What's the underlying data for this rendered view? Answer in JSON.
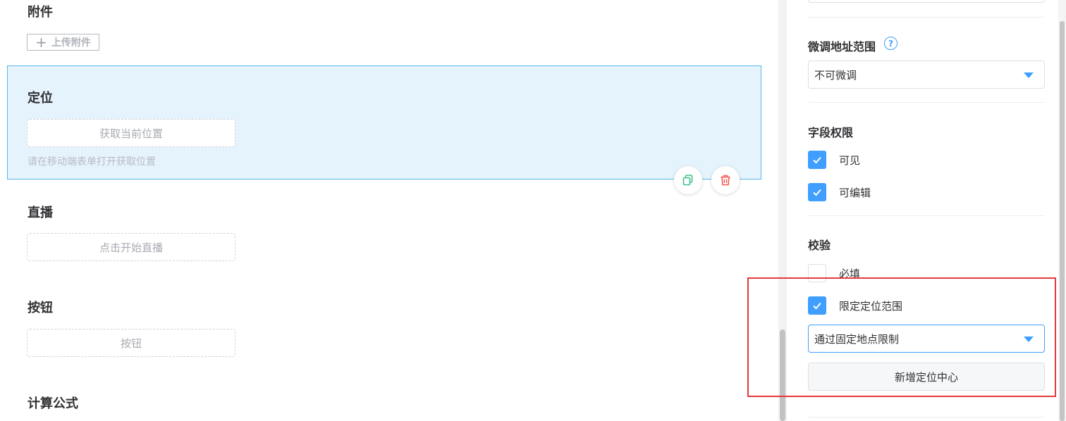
{
  "canvas": {
    "attachment": {
      "label": "附件",
      "upload_button": "上传附件",
      "upload_icon": "plus-icon"
    },
    "location": {
      "label": "定位",
      "get_location_button": "获取当前位置",
      "hint": "请在移动端表单打开获取位置"
    },
    "live": {
      "label": "直播",
      "start_live_button": "点击开始直播"
    },
    "button_field": {
      "label": "按钮",
      "button_text": "按钮"
    },
    "formula": {
      "label": "计算公式"
    },
    "actions": {
      "copy_icon": "copy-icon",
      "delete_icon": "trash-icon"
    }
  },
  "panel": {
    "adjust_range": {
      "title": "微调地址范围",
      "help_icon": "question-circle-icon",
      "help_glyph": "?",
      "select_value": "不可微调"
    },
    "permissions": {
      "title": "字段权限",
      "items": [
        {
          "label": "可见",
          "checked": true
        },
        {
          "label": "可编辑",
          "checked": true
        }
      ]
    },
    "validation": {
      "title": "校验",
      "items": [
        {
          "label": "必填",
          "checked": false
        },
        {
          "label": "限定定位范围",
          "checked": true
        }
      ],
      "limit_select_value": "通过固定地点限制",
      "add_center_button": "新增定位中心"
    }
  },
  "colors": {
    "accent": "#409eff",
    "selected_block_bg": "#e5f3fc",
    "selected_block_border": "#58b8e8",
    "copy_icon": "#3cc28a",
    "delete_icon": "#f25c54",
    "highlight_frame": "#e4393c"
  }
}
